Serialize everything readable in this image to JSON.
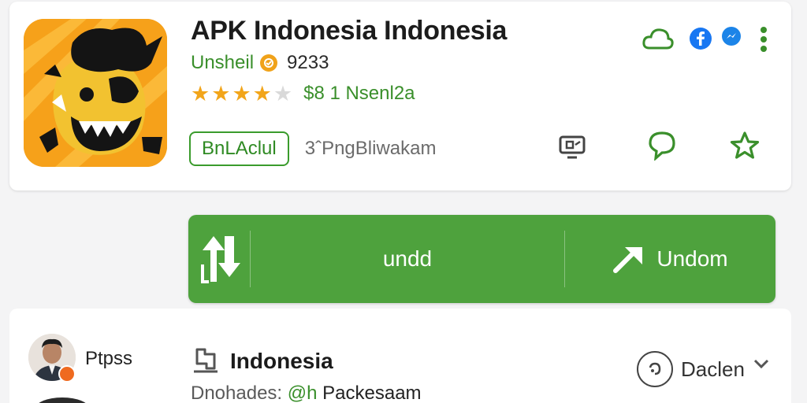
{
  "app": {
    "title": "APK Indonesia Indonesia",
    "developer": "Unsheil",
    "developer_count": "9233",
    "rating_stars": 4,
    "rating_max": 5,
    "rating_count": "$8  1 Nsenl2a",
    "action_pill": "BnLAclul",
    "meta_text": "3ˆPngBliwakam"
  },
  "header_icons": [
    "cloud-outline-icon",
    "facebook-icon",
    "messenger-icon",
    "more-vert-icon"
  ],
  "quick_actions": [
    "share-screen-icon",
    "chat-bubble-icon",
    "star-outline-icon"
  ],
  "install_bar": {
    "left_icon": "sort-arrows-icon",
    "middle_label": "undd",
    "right_label": "Undom",
    "right_icon": "arrow-up-right-icon"
  },
  "details": {
    "user_name": "Ptpss",
    "package_title": "Indonesia",
    "package_sub_prefix": "Dnohades:",
    "package_sub_handle": "@h",
    "package_sub_suffix": "Packesaam",
    "language_label": "Daclen"
  },
  "colors": {
    "accent_green": "#4ea23d",
    "text_green": "#3a8f2b",
    "star_gold": "#f2a51a",
    "facebook_blue": "#1877f2",
    "background": "#f4f4f5"
  }
}
